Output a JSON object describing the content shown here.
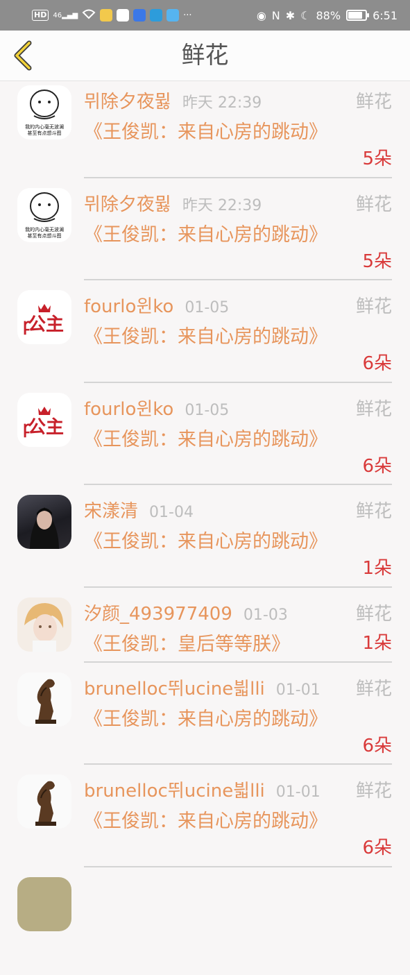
{
  "status_bar": {
    "left_labels": [
      "HD",
      "46"
    ],
    "battery": "88%",
    "time": "6:51"
  },
  "header": {
    "title": "鲜花"
  },
  "items": [
    {
      "name": "뮈除夕夜뮗",
      "date": "昨天 22:39",
      "type": "鲜花",
      "gift": "《王俊凯：来自心房的跳动》",
      "count": "5朵",
      "avatar": "meme-avatar"
    },
    {
      "name": "뮈除夕夜뮗",
      "date": "昨天 22:39",
      "type": "鲜花",
      "gift": "《王俊凯：来自心房的跳动》",
      "count": "5朵",
      "avatar": "meme-avatar"
    },
    {
      "name": "fourlo윈ko",
      "date": "01-05",
      "type": "鲜花",
      "gift": "《王俊凯：来自心房的跳动》",
      "count": "6朵",
      "avatar": "princess-avatar"
    },
    {
      "name": "fourlo윈ko",
      "date": "01-05",
      "type": "鲜花",
      "gift": "《王俊凯：来自心房的跳动》",
      "count": "6朵",
      "avatar": "princess-avatar"
    },
    {
      "name": "宋漾清",
      "date": "01-04",
      "type": "鲜花",
      "gift": "《王俊凯：来自心房的跳动》",
      "count": "1朵",
      "avatar": "photo-avatar"
    },
    {
      "name": "汐颜_493977409",
      "date": "01-03",
      "type": "鲜花",
      "gift": "《王俊凯：皇后等等朕》",
      "count": "1朵",
      "avatar": "anime-avatar"
    },
    {
      "name": "brunelloc뛰ucine븳lli",
      "date": "01-01",
      "type": "鲜花",
      "gift": "《王俊凯：来自心房的跳动》",
      "count": "6朵",
      "avatar": "horse-avatar"
    },
    {
      "name": "brunelloc뛰ucine븳lli",
      "date": "01-01",
      "type": "鲜花",
      "gift": "《王俊凯：来自心房的跳动》",
      "count": "6朵",
      "avatar": "horse-avatar"
    }
  ],
  "meme_text": [
    "我的内心毫无波澜",
    "甚至有点想斗图"
  ],
  "princess_text": "公主",
  "colors": {
    "accent": "#e7955c",
    "count": "#d93a3a",
    "muted": "#bdbdbd"
  }
}
